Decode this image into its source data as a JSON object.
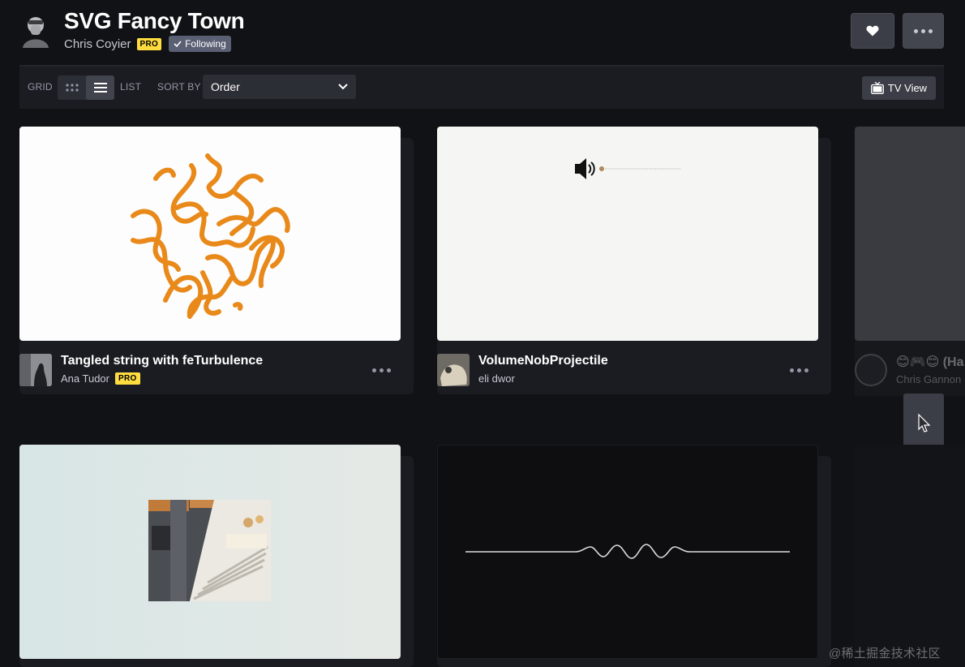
{
  "header": {
    "title": "SVG Fancy Town",
    "owner_name": "Chris Coyier",
    "owner_badge": "PRO",
    "following_label": "Following",
    "heart_icon": "heart-icon",
    "more_icon": "more-dots-icon"
  },
  "toolbar": {
    "grid_label": "GRID",
    "list_label": "LIST",
    "sort_by_label": "SORT BY",
    "sort_value": "Order",
    "tv_view_label": "TV View"
  },
  "cards": [
    {
      "title": "Tangled string with feTurbulence",
      "author": "Ana Tudor",
      "badge": "PRO"
    },
    {
      "title": "VolumeNobProjectile",
      "author": "eli dwor",
      "badge": ""
    },
    {
      "title": "😊🎮😊 (Ha",
      "author": "Chris Gannon",
      "badge": ""
    }
  ],
  "colors": {
    "background": "#111215",
    "toolbar": "#1b1c21",
    "pro_badge": "#ffdd40",
    "string_orange": "#e8891a"
  },
  "watermark": "@稀土掘金技术社区"
}
